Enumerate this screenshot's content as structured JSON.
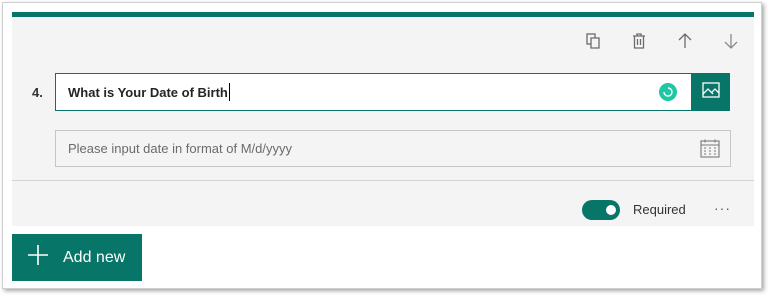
{
  "question": {
    "number": "4.",
    "title": "What is Your Date of Birth",
    "answer_placeholder": "Please input date in format of M/d/yyyy"
  },
  "toolbar": {
    "icons": [
      "copy-icon",
      "delete-icon",
      "move-up-icon",
      "move-down-icon"
    ]
  },
  "settings": {
    "required_label": "Required",
    "required": true,
    "more_label": "···"
  },
  "add_new": {
    "label": "Add new"
  },
  "colors": {
    "accent": "#077568",
    "card_bg": "#f4f4f4",
    "spinner": "#1fc8a3"
  }
}
